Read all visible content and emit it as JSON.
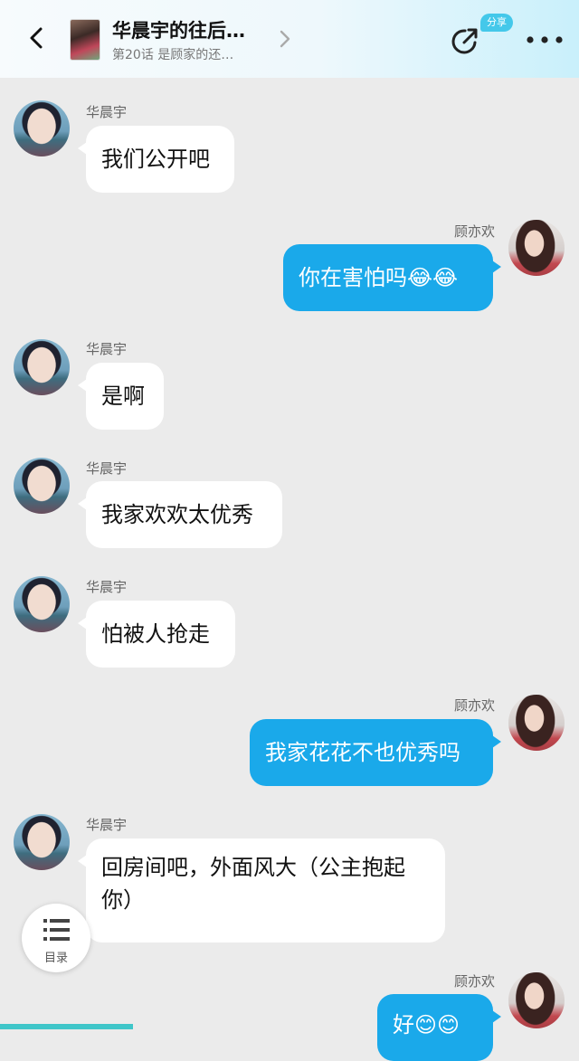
{
  "header": {
    "title": "华晨宇的往后…",
    "subtitle": "第20话 是顾家的还…",
    "share_badge": "分享",
    "back_icon": "chevron-left-icon",
    "share_icon": "share-icon",
    "more_icon": "more-horizontal-icon"
  },
  "messages": [
    {
      "side": "left",
      "sender": "华晨宇",
      "text": "我们公开吧"
    },
    {
      "side": "right",
      "sender": "顾亦欢",
      "text": "你在害怕吗😂😂"
    },
    {
      "side": "left",
      "sender": "华晨宇",
      "text": "是啊"
    },
    {
      "side": "left",
      "sender": "华晨宇",
      "text": "我家欢欢太优秀"
    },
    {
      "side": "left",
      "sender": "华晨宇",
      "text": "怕被人抢走"
    },
    {
      "side": "right",
      "sender": "顾亦欢",
      "text": "我家花花不也优秀吗"
    },
    {
      "side": "left",
      "sender": "华晨宇",
      "text": "回房间吧，外面风大（公主抱起你）"
    },
    {
      "side": "right",
      "sender": "顾亦欢",
      "text": "好😊😊"
    }
  ],
  "toc": {
    "label": "目录",
    "icon": "list-icon"
  },
  "reading_progress": 0.23,
  "colors": {
    "right_bubble": "#1aa9ea",
    "left_bubble": "#ffffff",
    "background": "#ebebeb",
    "progress": "#3fc6c9"
  }
}
